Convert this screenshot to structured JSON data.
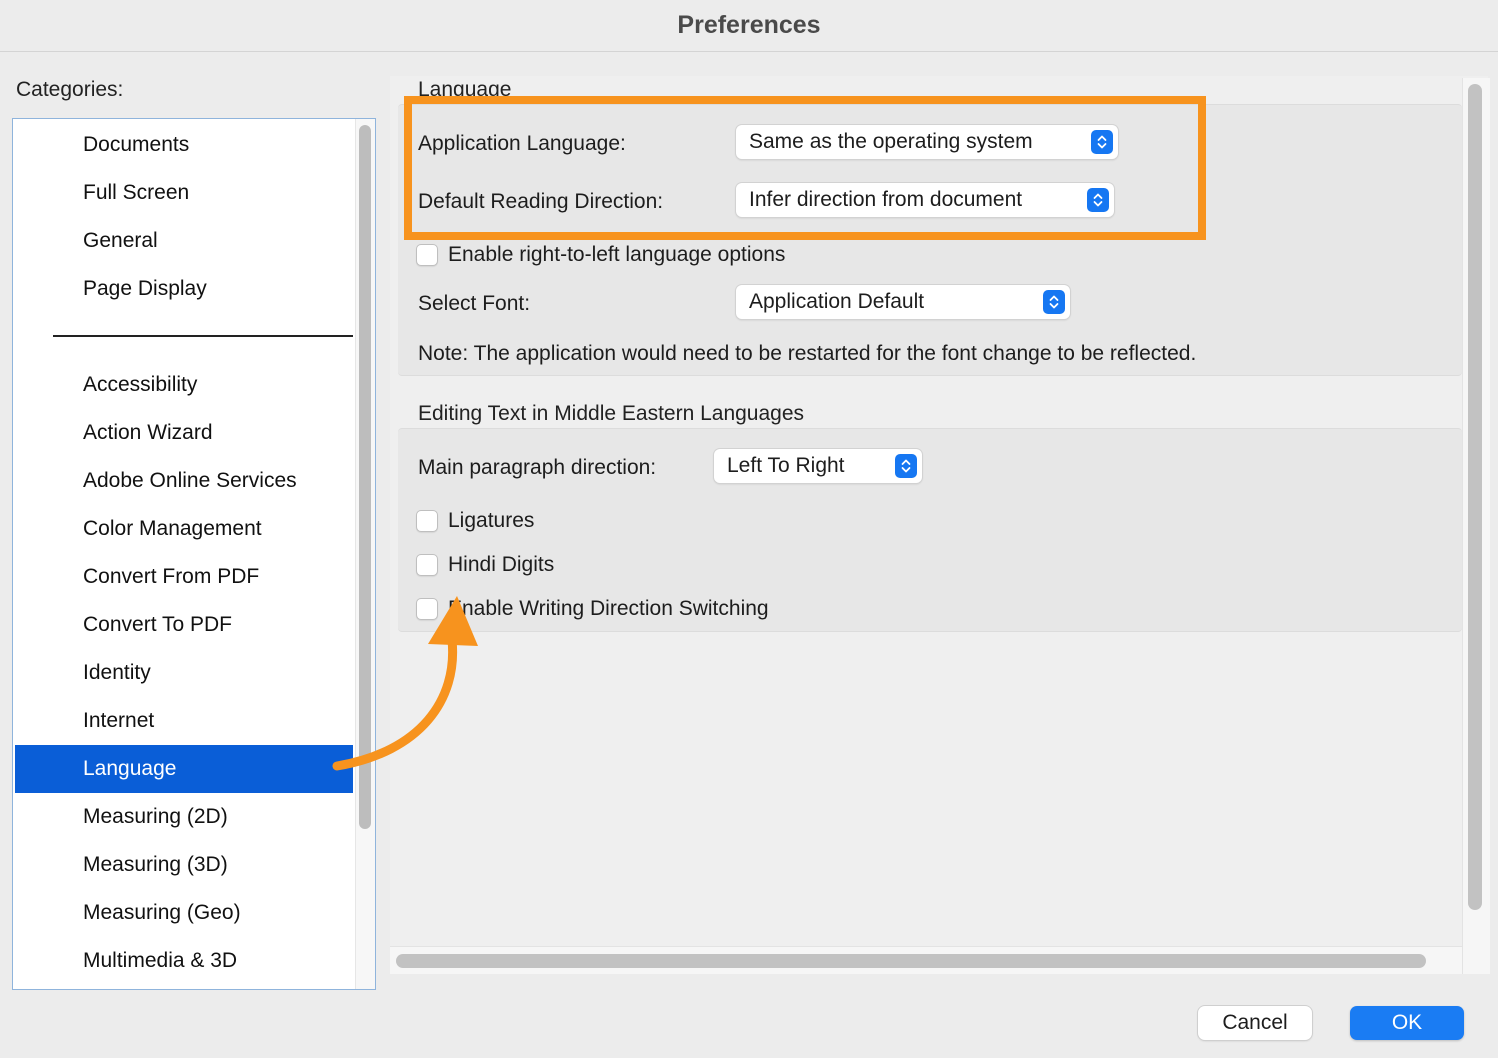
{
  "window": {
    "title": "Preferences"
  },
  "categories": {
    "label": "Categories:",
    "items_top": [
      "Documents",
      "Full Screen",
      "General",
      "Page Display"
    ],
    "items_bottom": [
      "Accessibility",
      "Action Wizard",
      "Adobe Online Services",
      "Color Management",
      "Convert From PDF",
      "Convert To PDF",
      "Identity",
      "Internet",
      "Language",
      "Measuring (2D)",
      "Measuring (3D)",
      "Measuring (Geo)",
      "Multimedia & 3D"
    ],
    "selected": "Language"
  },
  "language_section": {
    "title": "Language",
    "app_language": {
      "label": "Application Language:",
      "value": "Same as the operating system"
    },
    "reading_direction": {
      "label": "Default Reading Direction:",
      "value": "Infer direction from document"
    },
    "rtl_checkbox": {
      "label": "Enable right-to-left language options",
      "checked": false
    },
    "select_font": {
      "label": "Select Font:",
      "value": "Application Default"
    },
    "note": "Note: The application would need to be restarted for the font change to be reflected."
  },
  "middle_eastern_section": {
    "title": "Editing Text in Middle Eastern Languages",
    "paragraph_direction": {
      "label": "Main paragraph direction:",
      "value": "Left To Right"
    },
    "ligatures": {
      "label": "Ligatures",
      "checked": false
    },
    "hindi_digits": {
      "label": "Hindi Digits",
      "checked": false
    },
    "writing_direction": {
      "label": "Enable Writing Direction Switching",
      "checked": false
    }
  },
  "buttons": {
    "cancel": "Cancel",
    "ok": "OK"
  },
  "annotation": {
    "highlight_color": "#f7931e",
    "selection_color": "#0a5ed7",
    "accent_color": "#1a7cf3"
  }
}
